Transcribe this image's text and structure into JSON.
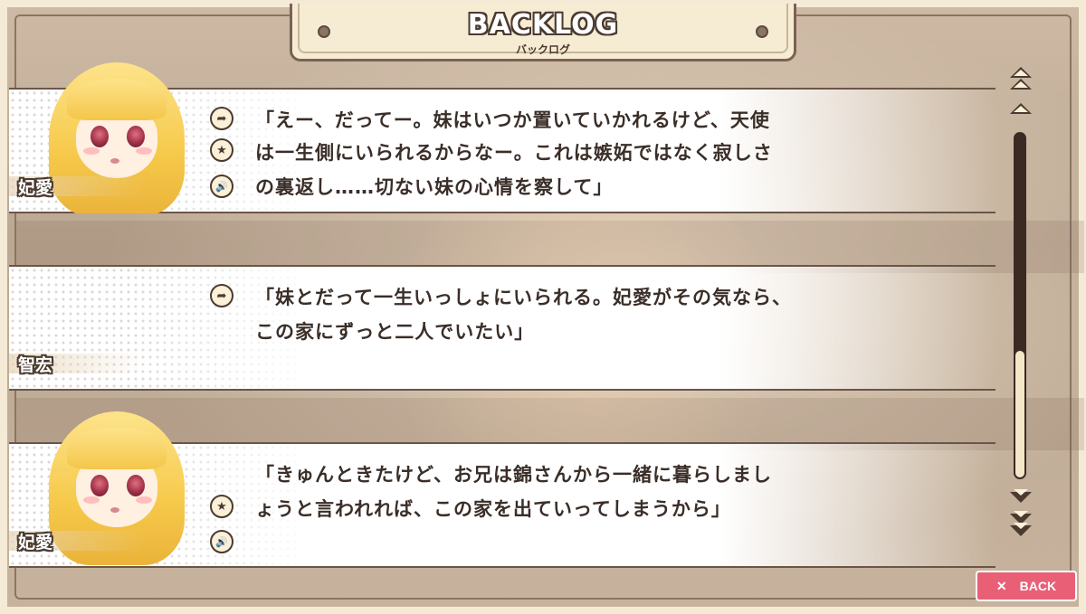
{
  "header": {
    "title": "BACKLOG",
    "subtitle": "バックログ"
  },
  "entries": [
    {
      "speaker": "妃愛",
      "lines": [
        "「えー、だってー。妹はいつか置いていかれるけど、天使",
        "は一生側にいられるからなー。これは嫉妬ではなく寂しさ",
        "の裏返し……切ない妹の心情を察して」"
      ],
      "buttons": [
        "jump-icon",
        "favorite-icon",
        "voice-icon"
      ],
      "portrait": true
    },
    {
      "speaker": "智宏",
      "lines": [
        "「妹とだって一生いっしょにいられる。妃愛がその気なら、",
        "この家にずっと二人でいたい」"
      ],
      "buttons": [
        "jump-icon"
      ],
      "portrait": false
    },
    {
      "speaker": "妃愛",
      "lines": [
        "「きゅんときたけど、お兄は錦さんから一緒に暮らしまし",
        "ょうと言われれば、この家を出ていってしまうから」"
      ],
      "buttons": [
        "favorite-icon",
        "voice-icon"
      ],
      "portrait": true
    }
  ],
  "icons": {
    "jump": "➦",
    "favorite": "★",
    "voice": "🔊"
  },
  "scroll": {
    "position": 0.65
  },
  "back_button": {
    "icon": "✕",
    "label": "BACK"
  },
  "colors": {
    "back": "#e95f76",
    "outline": "#4a3a30",
    "frame": "#f4ead6"
  }
}
